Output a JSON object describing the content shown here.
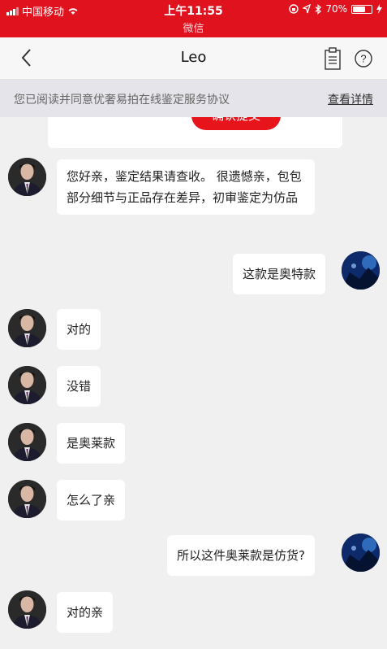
{
  "status_bar": {
    "carrier": "中国移动",
    "time": "上午11:55",
    "battery": "70%",
    "battery_level": 0.7,
    "app_name": "微信"
  },
  "nav": {
    "title": "Leo",
    "help_symbol": "?"
  },
  "notice": {
    "text": "您已阅读并同意优奢易拍在线鉴定服务协议",
    "link_label": "查看详情"
  },
  "chat": {
    "confirm_button": "确认提交",
    "messages": [
      {
        "from": "agent",
        "text": "您好亲，鉴定结果请查收。 很遗憾亲，包包部分细节与正品存在差异，初审鉴定为仿品"
      },
      {
        "from": "user",
        "text": "这款是奥特款"
      },
      {
        "from": "agent",
        "text": "对的"
      },
      {
        "from": "agent",
        "text": "没错"
      },
      {
        "from": "agent",
        "text": "是奥莱款"
      },
      {
        "from": "agent",
        "text": "怎么了亲"
      },
      {
        "from": "user",
        "text": "所以这件奥莱款是仿货?"
      },
      {
        "from": "agent",
        "text": "对的亲"
      }
    ]
  },
  "colors": {
    "accent": "#e0121e",
    "chat_background": "#f0f0f0",
    "bubble": "#ffffff",
    "notice_background": "#e4e4ea"
  }
}
